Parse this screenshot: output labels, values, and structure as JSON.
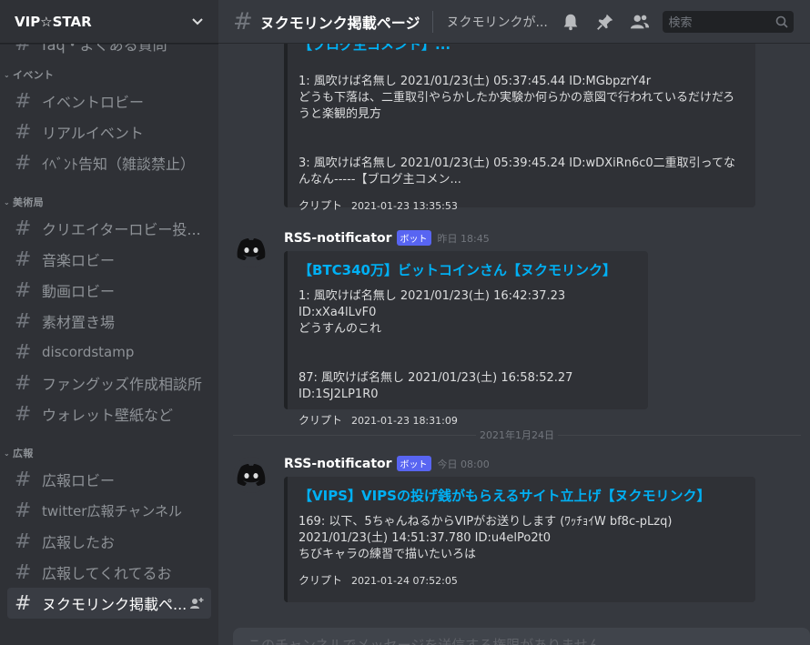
{
  "server": {
    "name": "VIP☆STAR"
  },
  "sidebar": {
    "partial_top": "faq・よくある質問",
    "categories": [
      {
        "name": "イベント",
        "channels": [
          "イベントロビー",
          "リアルイベント",
          "ｲﾍﾞﾝﾄ告知（雑談禁止）"
        ]
      },
      {
        "name": "美術局",
        "channels": [
          "クリエイターロビー投...",
          "音楽ロビー",
          "動画ロビー",
          "素材置き場",
          "discordstamp",
          "ファングッズ作成相談所",
          "ウォレット壁紙など"
        ]
      },
      {
        "name": "広報",
        "channels": [
          "広報ロビー",
          "twitter広報チャンネル",
          "広報したお",
          "広報してくれてるお",
          "ヌクモリンク掲載ペ..."
        ]
      }
    ]
  },
  "header": {
    "channel_name": "ヌクモリンク掲載ページ",
    "topic": "ヌクモリンクが...",
    "search_placeholder": "検索"
  },
  "messages": {
    "m0": {
      "title_partial": "【ブログ主コメント】...",
      "desc": "1: 風吹けば名無し 2021/01/23(土) 05:37:45.44 ID:MGbpzrY4r\nどうも下落は、二重取引やらかしたか実験か何らかの意図で行われているだけだろうと楽観的見方\n\n\n3: 風吹けば名無し 2021/01/23(土) 05:39:45.24 ID:wDXiRn6c0二重取引ってなんなん-----【ブログ主コメン...",
      "footer": "クリプト",
      "footer_time": "2021-01-23 13:35:53"
    },
    "m1": {
      "author": "RSS-notificator",
      "bot_tag": "ボット",
      "timestamp": "昨日 18:45",
      "title": "【BTC340万】ビットコインさん【ヌクモリンク】",
      "desc": "1: 風吹けば名無し 2021/01/23(土) 16:42:37.23 ID:xXa4lLvF0\nどうすんのこれ\n\n\n87: 風吹けば名無し 2021/01/23(土) 16:58:52.27 ID:1SJ2LP1R0",
      "footer": "クリプト",
      "footer_time": "2021-01-23 18:31:09"
    },
    "date_divider": "2021年1月24日",
    "m2": {
      "author": "RSS-notificator",
      "bot_tag": "ボット",
      "timestamp": "今日 08:00",
      "title": "【VIPS】VIPSの投げ銭がもらえるサイト立上げ【ヌクモリンク】",
      "desc": "169: 以下、5ちゃんねるからVIPがお送りします (ﾜｯﾁｮｲW bf8c-pLzq)\n2021/01/23(土) 14:51:37.780 ID:u4elPo2t0\nちびキャラの練習で描いたいろは",
      "footer": "クリプト",
      "footer_time": "2021-01-24 07:52:05"
    }
  },
  "composer": {
    "placeholder": "このチャンネルでメッセージを送信する権限がありません"
  }
}
